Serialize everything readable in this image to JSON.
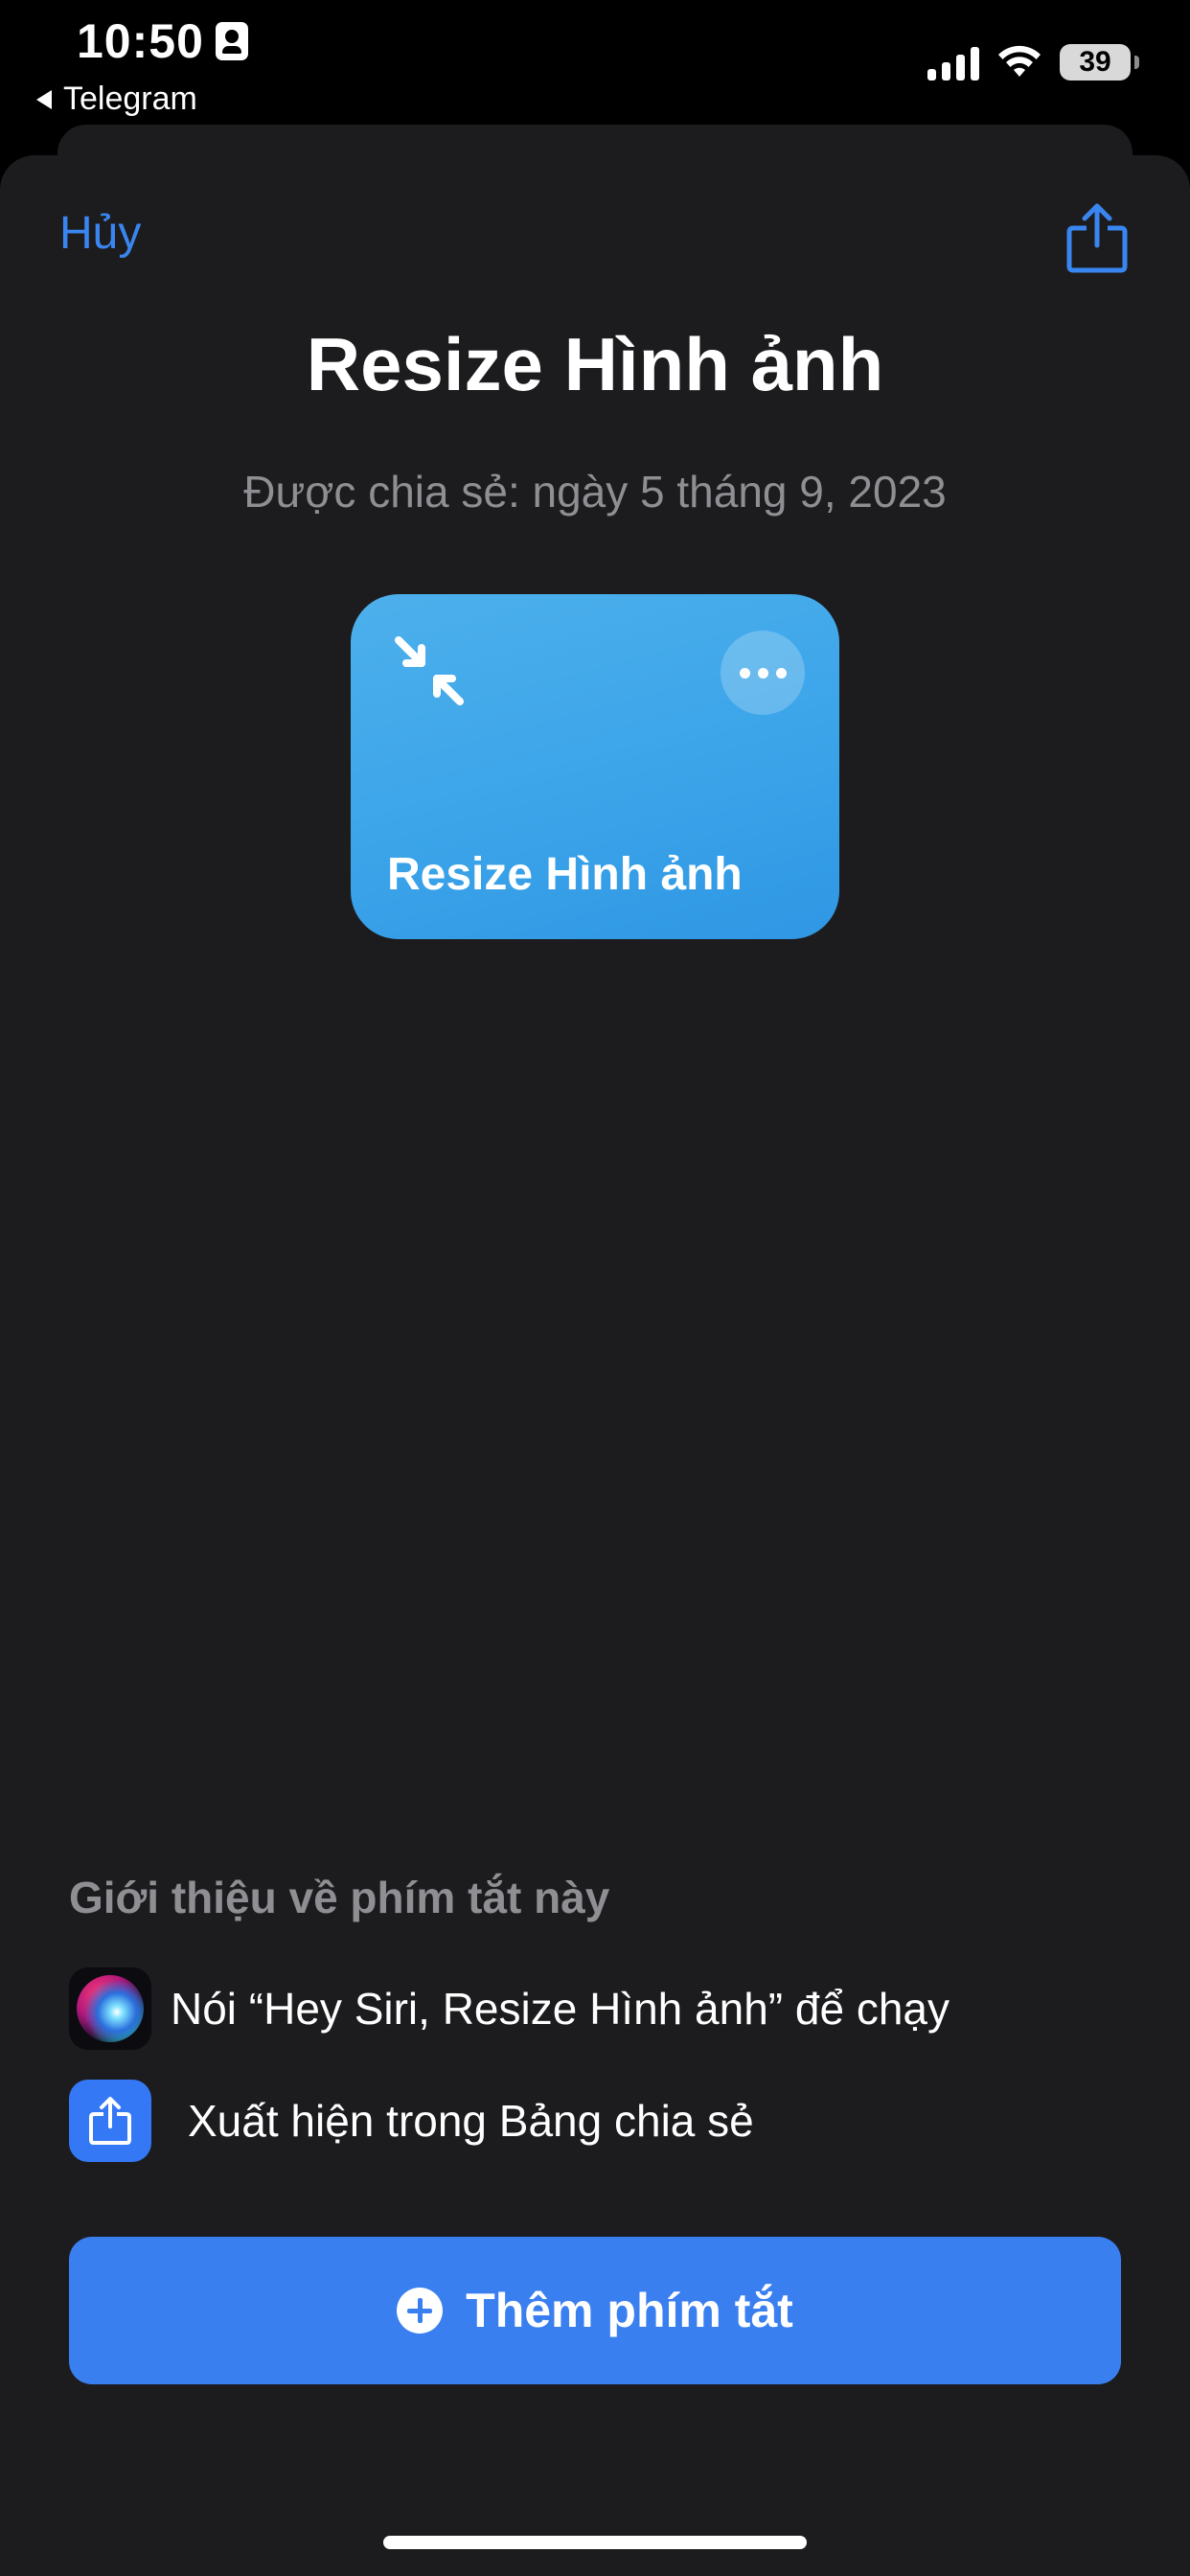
{
  "status_bar": {
    "time": "10:50",
    "back_app": "Telegram",
    "battery": "39",
    "icons": [
      "contact-card-icon",
      "cellular-signal-icon",
      "wifi-icon",
      "battery-icon"
    ]
  },
  "header": {
    "cancel_label": "Hủy",
    "share_icon": "share-icon"
  },
  "shortcut": {
    "title": "Resize Hình ảnh",
    "shared_date": "Được chia sẻ: ngày 5 tháng 9, 2023",
    "card_name": "Resize Hình ảnh",
    "card_color": "#3ba4e9",
    "card_icon": "arrows-inward-icon",
    "more_icon": "ellipsis-icon"
  },
  "about": {
    "heading": "Giới thiệu về phím tắt này",
    "items": [
      {
        "icon": "siri-icon",
        "text": "Nói “Hey Siri, Resize Hình ảnh” để chạy"
      },
      {
        "icon": "share-sheet-icon",
        "text": "Xuất hiện trong Bảng chia sẻ"
      }
    ]
  },
  "add_button": {
    "label": "Thêm phím tắt",
    "icon": "plus-circle-icon",
    "color": "#3a7ff0"
  },
  "colors": {
    "accent": "#3a86f0",
    "sheet_background": "#1c1c1e",
    "secondary_text": "#8e8e93"
  }
}
